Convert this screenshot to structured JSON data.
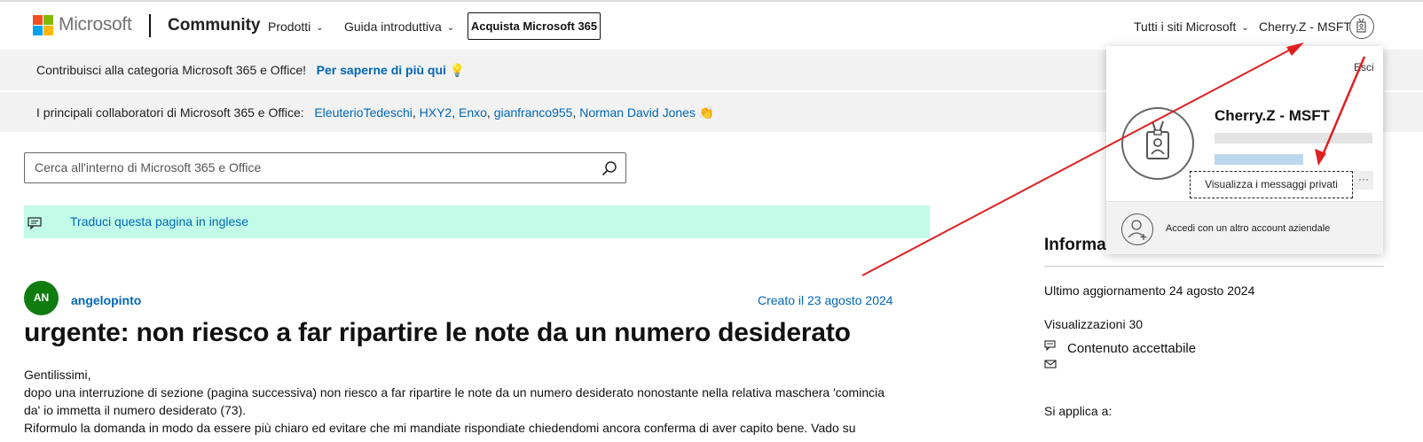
{
  "header": {
    "brand": "Microsoft",
    "section": "Community",
    "nav_products": "Prodotti",
    "nav_guide": "Guida introduttiva",
    "buy_button": "Acquista Microsoft 365",
    "all_sites": "Tutti i siti Microsoft",
    "user_name": "Cherry.Z - MSFT"
  },
  "banner_contribute": {
    "text": "Contribuisci alla categoria Microsoft 365 e Office!",
    "link": "Per saperne di più qui",
    "emoji": "💡"
  },
  "banner_top": {
    "text": "I principali collaboratori di Microsoft 365 e Office:",
    "contributors": [
      "EleuterioTedeschi",
      "HXY2",
      "Enxo",
      "gianfranco955",
      "Norman David Jones"
    ],
    "separators": [
      ", ",
      ", ",
      ", ",
      ", "
    ],
    "emoji": "👏"
  },
  "search": {
    "placeholder": "Cerca all'interno di Microsoft 365 e Office"
  },
  "translate": {
    "text": "Traduci questa pagina in inglese"
  },
  "post": {
    "avatar_initials": "AN",
    "author": "angelopinto",
    "created": "Creato il 23 agosto 2024",
    "title": "urgente: non riesco a far ripartire le note da un numero desiderato",
    "body": [
      "Gentilissimi,",
      "dopo una interruzione di sezione (pagina successiva) non riesco a far ripartire le note da un numero desiderato nonostante nella relativa maschera 'comincia",
      "da' io immetta il numero desiderato (73).",
      "Riformulo la domanda in modo da essere più chiaro ed evitare che mi mandiate rispondiate chiedendomi ancora conferma di aver capito bene. Vado su"
    ]
  },
  "sidebar": {
    "heading": "Informa",
    "last_update": "Ultimo aggiornamento 24 agosto 2024",
    "views": "Visualizzazioni 30",
    "acceptable": "Contenuto accettabile",
    "applies_to": "Si applica a:"
  },
  "popup": {
    "sign_out": "Esci",
    "name": "Cherry.Z - MSFT",
    "private_messages": "Visualizza i messaggi privati",
    "more": "···",
    "other_account": "Accedi con un altro account aziendale"
  },
  "colors": {
    "link": "#0067b8",
    "translate_bg": "#c2fce8",
    "banner_bg": "#f2f2f2",
    "avatar_bg": "#107c10",
    "arrow": "#e02020",
    "ms_red": "#f25022",
    "ms_green": "#7fba00",
    "ms_blue": "#00a4ef",
    "ms_yellow": "#ffb900"
  }
}
